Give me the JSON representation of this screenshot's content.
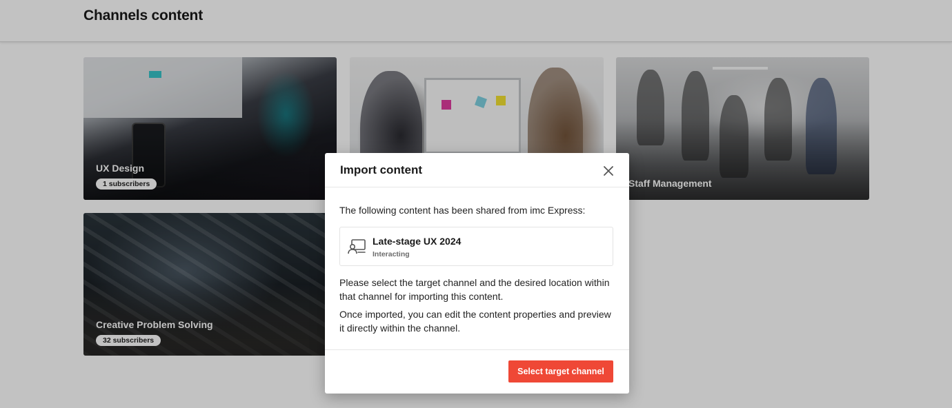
{
  "page": {
    "title": "Channels content"
  },
  "channels": [
    {
      "title": "UX Design",
      "subscribers": "1 subscribers"
    },
    {
      "title": "",
      "subscribers": ""
    },
    {
      "title": "Staff Management",
      "subscribers": ""
    },
    {
      "title": "Creative Problem Solving",
      "subscribers": "32 subscribers"
    }
  ],
  "modal": {
    "title": "Import content",
    "close_icon": "close-icon",
    "intro": "The following content has been shared from imc Express:",
    "item": {
      "icon": "presentation-icon",
      "title": "Late-stage UX 2024",
      "status": "Interacting"
    },
    "paragraph_1": "Please select the target channel and the desired location within that channel for importing this content.",
    "paragraph_2": "Once imported, you can edit the content properties and preview it directly within the channel.",
    "primary_button": "Select target channel"
  },
  "colors": {
    "accent": "#ef4836",
    "backdrop": "rgba(0,0,0,0.24)"
  }
}
